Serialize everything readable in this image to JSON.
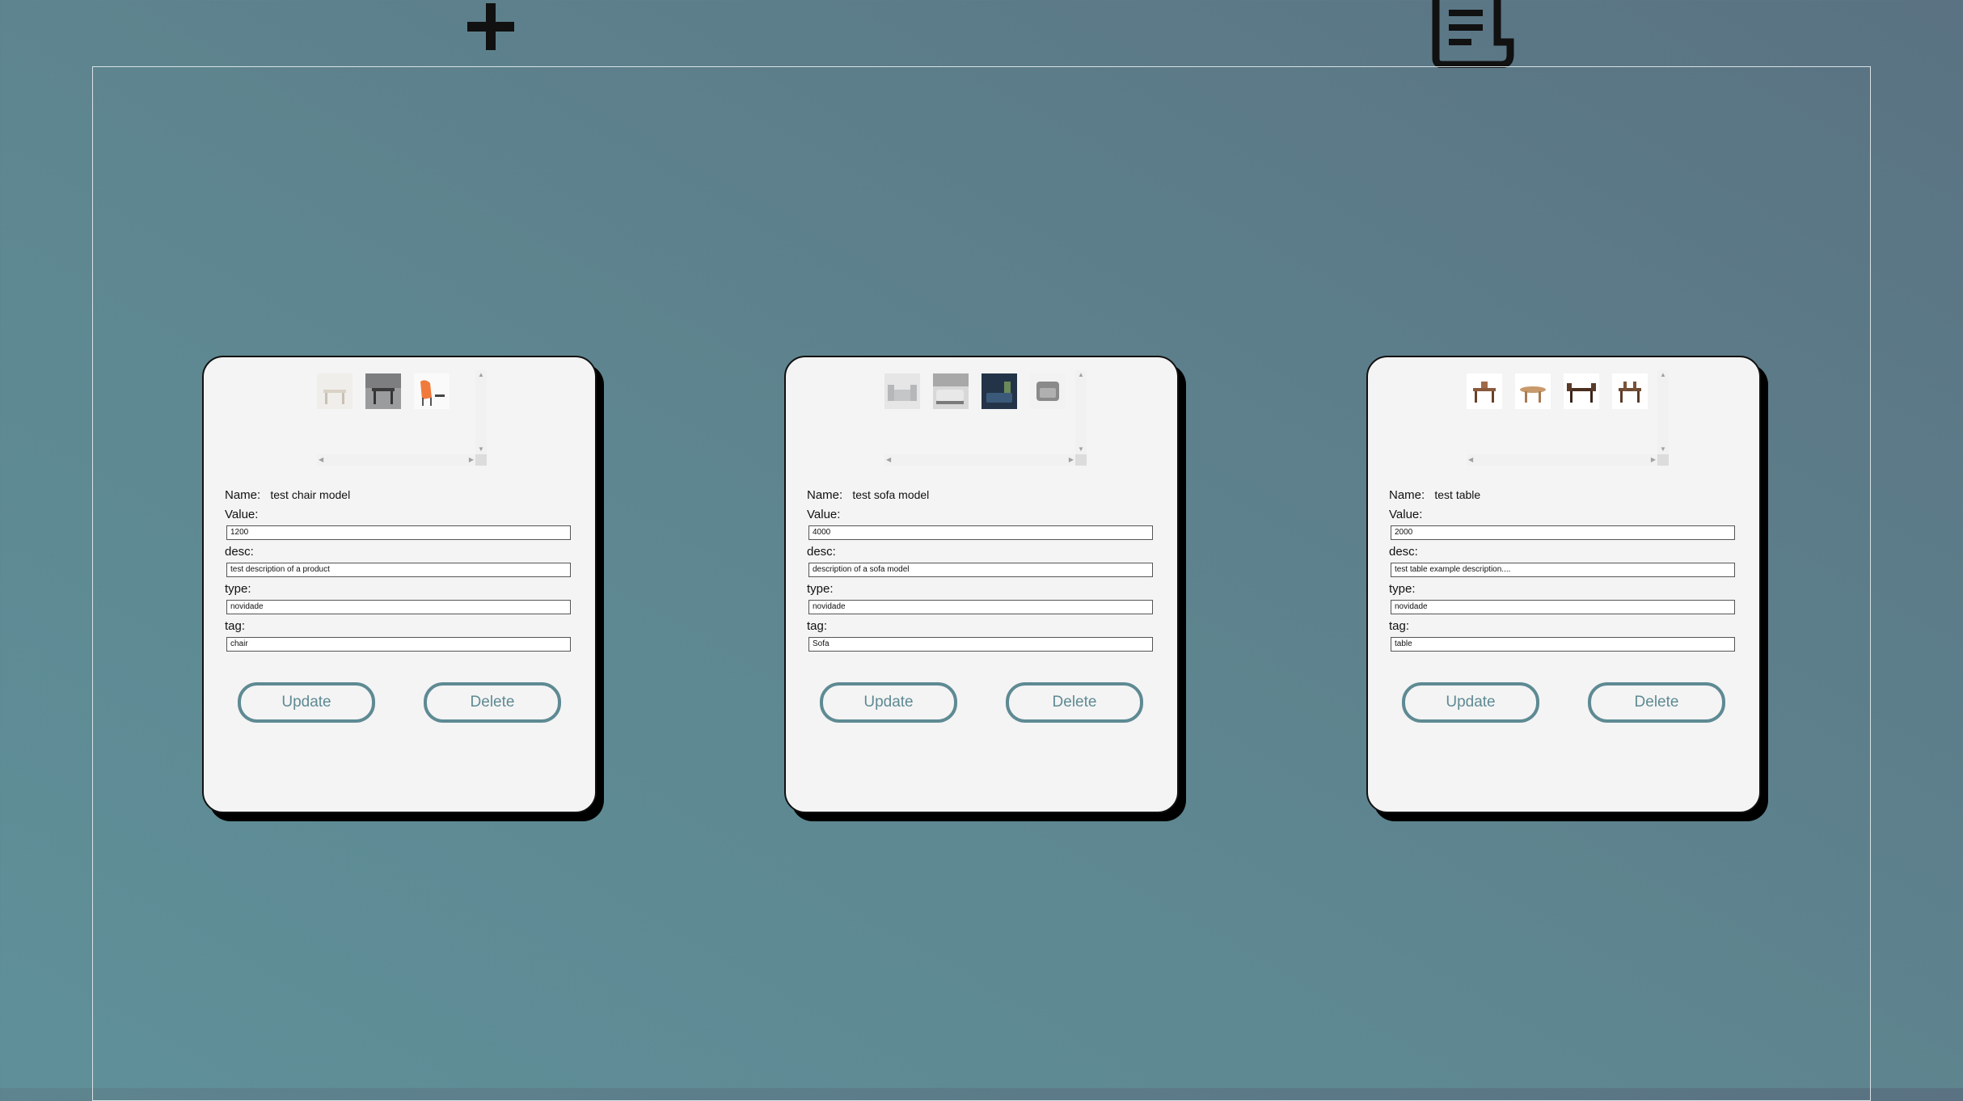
{
  "toolbar": {
    "add_icon": "plus-icon",
    "list_icon": "document-list-icon"
  },
  "labels": {
    "name": "Name:",
    "value": "Value:",
    "desc": "desc:",
    "type": "type:",
    "tag": "tag:",
    "update": "Update",
    "delete": "Delete"
  },
  "products": [
    {
      "name": "test chair model",
      "value": "1200",
      "desc": "test description of a product",
      "type": "novidade",
      "tag": "chair",
      "thumbs": [
        "#e8e6e2",
        "#7d7f82",
        "#ef7a3c"
      ]
    },
    {
      "name": "test sofa model",
      "value": "4000",
      "desc": "description of a sofa model",
      "type": "novidade",
      "tag": "Sofa",
      "thumbs": [
        "#c9cbcc",
        "#b5b7b9",
        "#2b3a4c",
        "#9a9a9a"
      ]
    },
    {
      "name": "test table",
      "value": "2000",
      "desc": "test table example description....",
      "type": "novidade",
      "tag": "table",
      "thumbs": [
        "#8a5a3c",
        "#b88a5e",
        "#5a3a28",
        "#6e4a32"
      ]
    }
  ]
}
